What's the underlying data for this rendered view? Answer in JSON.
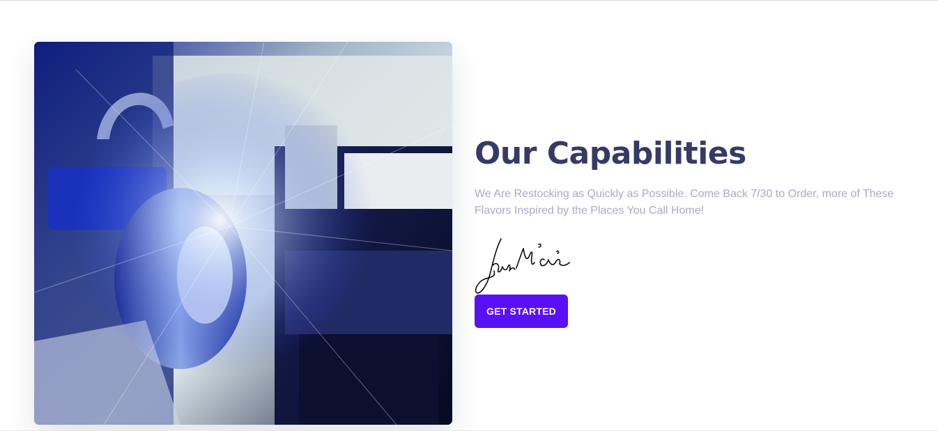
{
  "section": {
    "title": "Our Capabilities",
    "description": "We Are Restocking as Quickly as Possible. Come Back 7/30 to Order, more of These Flavors Inspired by the Places You Call Home!",
    "signature_text": "John McLain",
    "cta_label": "GET STARTED"
  },
  "colors": {
    "heading": "#353b66",
    "body_text": "#a9aac6",
    "accent": "#5a10f5"
  }
}
